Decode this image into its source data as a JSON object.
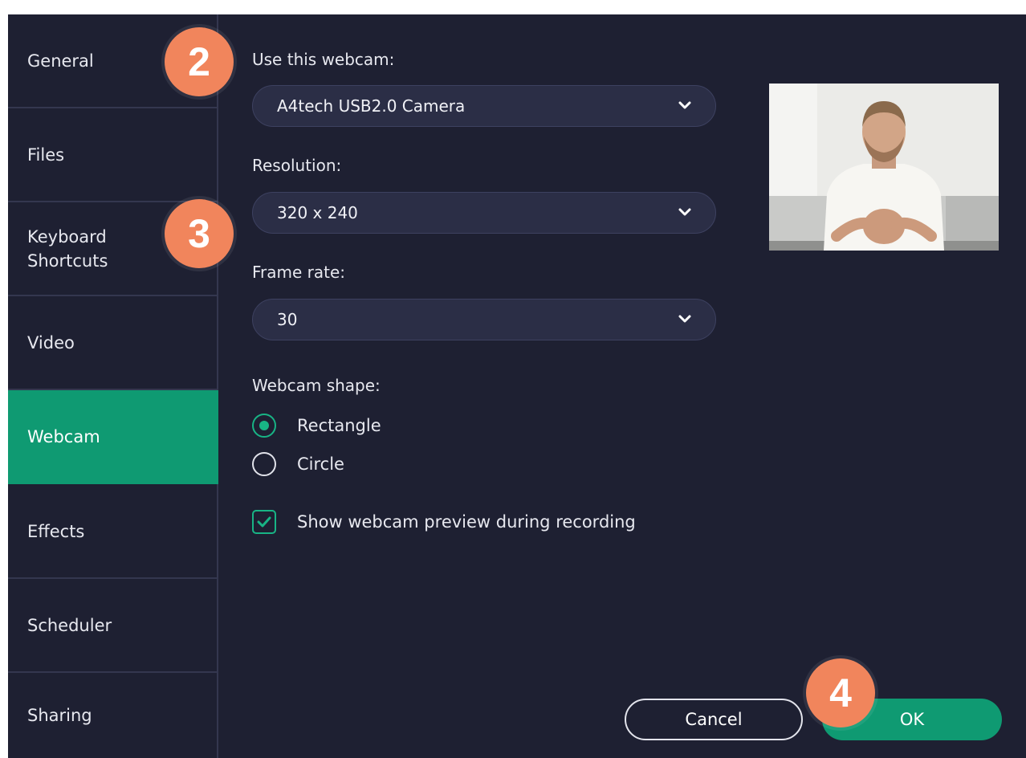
{
  "sidebar": {
    "items": [
      {
        "label": "General"
      },
      {
        "label": "Files"
      },
      {
        "label": "Keyboard\nShortcuts"
      },
      {
        "label": "Video"
      },
      {
        "label": "Webcam",
        "active": true
      },
      {
        "label": "Effects"
      },
      {
        "label": "Scheduler"
      },
      {
        "label": "Sharing"
      }
    ]
  },
  "webcam": {
    "label": "Use this webcam:",
    "value": "A4tech USB2.0 Camera"
  },
  "resolution": {
    "label": "Resolution:",
    "value": "320 x 240"
  },
  "frame_rate": {
    "label": "Frame rate:",
    "value": "30"
  },
  "shape": {
    "label": "Webcam shape:",
    "options": [
      {
        "label": "Rectangle",
        "selected": true
      },
      {
        "label": "Circle",
        "selected": false
      }
    ]
  },
  "preview_option": {
    "label": "Show webcam preview during recording",
    "checked": true
  },
  "buttons": {
    "cancel": "Cancel",
    "ok": "OK"
  },
  "badges": [
    "2",
    "3",
    "4"
  ],
  "icons": {
    "dropdown": "chevron-down-icon",
    "checkbox": "checkmark-icon"
  },
  "colors": {
    "background": "#1e2032",
    "accent": "#0f9a72",
    "badge": "#f1855c",
    "field": "#2b2e46"
  }
}
